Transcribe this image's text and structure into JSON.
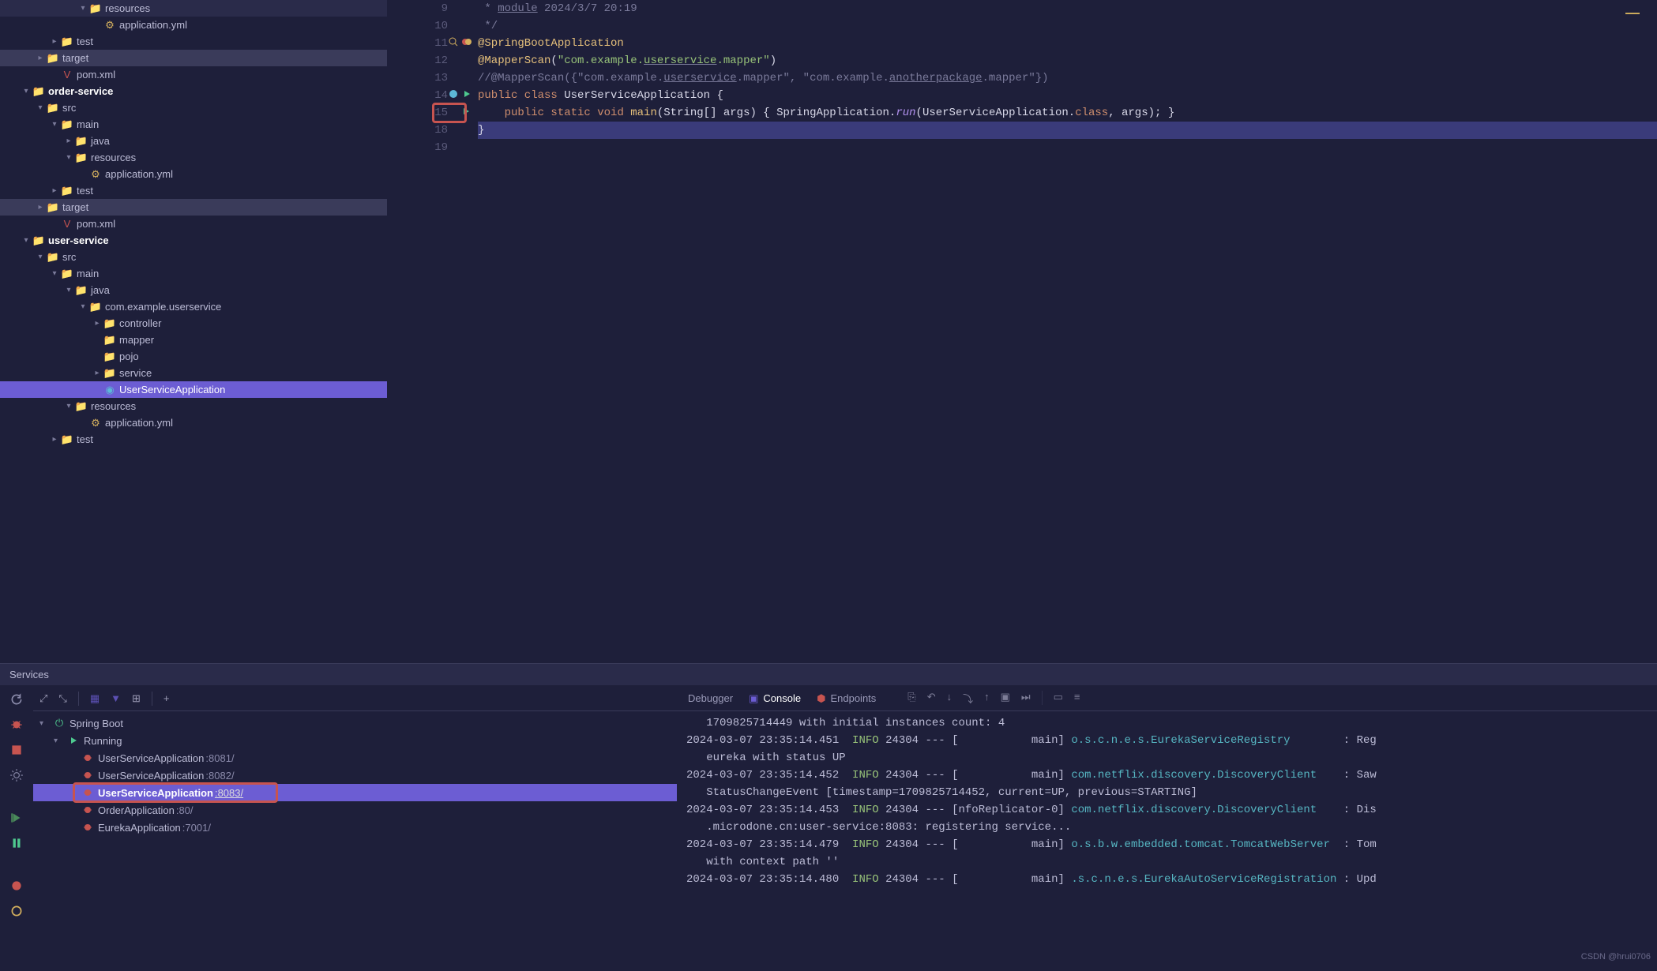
{
  "project_tree": [
    {
      "indent": 5,
      "chev": "v",
      "icon": "📁",
      "iconCls": "folder-purple",
      "label": "resources"
    },
    {
      "indent": 6,
      "chev": "",
      "icon": "⚙",
      "iconCls": "file-yellow",
      "label": "application.yml"
    },
    {
      "indent": 3,
      "chev": ">",
      "icon": "📁",
      "iconCls": "folder-green",
      "label": "test"
    },
    {
      "indent": 2,
      "chev": ">",
      "icon": "📁",
      "iconCls": "folder-maroon",
      "label": "target",
      "highlight": true
    },
    {
      "indent": 3,
      "chev": "",
      "icon": "V",
      "iconCls": "file-red",
      "label": "pom.xml"
    },
    {
      "indent": 1,
      "chev": "v",
      "icon": "📁",
      "iconCls": "folder-grey",
      "label": "order-service",
      "bold": true
    },
    {
      "indent": 2,
      "chev": "v",
      "icon": "📁",
      "iconCls": "folder-blue",
      "label": "src"
    },
    {
      "indent": 3,
      "chev": "v",
      "icon": "📁",
      "iconCls": "folder-grey",
      "label": "main"
    },
    {
      "indent": 4,
      "chev": ">",
      "icon": "📁",
      "iconCls": "folder-blue",
      "label": "java"
    },
    {
      "indent": 4,
      "chev": "v",
      "icon": "📁",
      "iconCls": "folder-purple",
      "label": "resources"
    },
    {
      "indent": 5,
      "chev": "",
      "icon": "⚙",
      "iconCls": "file-yellow",
      "label": "application.yml"
    },
    {
      "indent": 3,
      "chev": ">",
      "icon": "📁",
      "iconCls": "folder-green",
      "label": "test"
    },
    {
      "indent": 2,
      "chev": ">",
      "icon": "📁",
      "iconCls": "folder-maroon",
      "label": "target",
      "highlight": true
    },
    {
      "indent": 3,
      "chev": "",
      "icon": "V",
      "iconCls": "file-red",
      "label": "pom.xml"
    },
    {
      "indent": 1,
      "chev": "v",
      "icon": "📁",
      "iconCls": "folder-grey",
      "label": "user-service",
      "bold": true
    },
    {
      "indent": 2,
      "chev": "v",
      "icon": "📁",
      "iconCls": "folder-blue",
      "label": "src"
    },
    {
      "indent": 3,
      "chev": "v",
      "icon": "📁",
      "iconCls": "folder-grey",
      "label": "main"
    },
    {
      "indent": 4,
      "chev": "v",
      "icon": "📁",
      "iconCls": "folder-grey",
      "label": "java"
    },
    {
      "indent": 5,
      "chev": "v",
      "icon": "📁",
      "iconCls": "folder-grey",
      "label": "com.example.userservice"
    },
    {
      "indent": 6,
      "chev": ">",
      "icon": "📁",
      "iconCls": "file-pink",
      "label": "controller"
    },
    {
      "indent": 6,
      "chev": "",
      "icon": "📁",
      "iconCls": "folder-yellow",
      "label": "mapper"
    },
    {
      "indent": 6,
      "chev": "",
      "icon": "📁",
      "iconCls": "folder-yellow",
      "label": "pojo"
    },
    {
      "indent": 6,
      "chev": ">",
      "icon": "📁",
      "iconCls": "folder-blue",
      "label": "service"
    },
    {
      "indent": 6,
      "chev": "",
      "icon": "◉",
      "iconCls": "file-cyan",
      "label": "UserServiceApplication",
      "selected": true
    },
    {
      "indent": 4,
      "chev": "v",
      "icon": "📁",
      "iconCls": "folder-purple",
      "label": "resources"
    },
    {
      "indent": 5,
      "chev": "",
      "icon": "⚙",
      "iconCls": "file-yellow",
      "label": "application.yml"
    },
    {
      "indent": 3,
      "chev": ">",
      "icon": "📁",
      "iconCls": "folder-green",
      "label": "test"
    }
  ],
  "editor_lines": [
    {
      "num": 9,
      "html": " <span class='kw-grey'>* <span class='underline'>module</span> 2024/3/7 20:19</span>"
    },
    {
      "num": 10,
      "html": " <span class='kw-grey'>*/</span>"
    },
    {
      "num": 11,
      "html": "<span class='kw-yellow'>@SpringBootApplication</span>",
      "gutter": "magnify-circles"
    },
    {
      "num": 12,
      "html": "<span class='kw-yellow'>@MapperScan</span><span class='kw-white'>(</span><span class='kw-green'>\"com.example.<span class='underline'>userservice</span>.mapper\"</span><span class='kw-white'>)</span>"
    },
    {
      "num": 13,
      "html": "<span class='kw-grey'>//@MapperScan({\"com.example.<span class='underline'>userservice</span>.mapper\", \"com.example.<span class='underline'>anotherpackage</span>.mapper\"})</span>"
    },
    {
      "num": 14,
      "html": "<span class='kw-orange'>public class </span><span class='kw-white'>UserServiceApplication {</span>",
      "gutter": "run-both"
    },
    {
      "num": 15,
      "html": "    <span class='kw-orange'>public static </span><span class='kw-orange'>void </span><span class='kw-yellow'>main</span><span class='kw-white'>(</span><span class='kw-white'>String[] args</span><span class='kw-white'>) { </span><span class='kw-white'>SpringApplication.</span><span class='kw-purple kw-italic'>run</span><span class='kw-white'>(UserServiceApplication.</span><span class='kw-orange'>class</span><span class='kw-white'>, args); }</span>",
      "gutter": "run",
      "redbox": true
    },
    {
      "num": 18,
      "html": "<span class='kw-white'>}</span>",
      "hl": true
    },
    {
      "num": 19,
      "html": ""
    }
  ],
  "services": {
    "title": "Services",
    "spring_boot": "Spring Boot",
    "running": "Running",
    "runs": [
      {
        "name": "UserServiceApplication",
        "port": ":8081/"
      },
      {
        "name": "UserServiceApplication",
        "port": ":8082/"
      },
      {
        "name": "UserServiceApplication",
        "port": ":8083/",
        "selected": true,
        "box": true
      },
      {
        "name": "OrderApplication",
        "port": ":80/"
      },
      {
        "name": "EurekaApplication",
        "port": ":7001/"
      }
    ],
    "tabs": {
      "debugger": "Debugger",
      "console": "Console",
      "endpoints": "Endpoints"
    }
  },
  "console_lines": [
    {
      "text": "   1709825714449 with initial instances count: 4",
      "plain": true
    },
    {
      "ts": "2024-03-07 23:35:14.451",
      "lvl": "INFO",
      "pid": "24304",
      "thread": "main",
      "cls": "o.s.c.n.e.s.EurekaServiceRegistry",
      "msg": ": Reg"
    },
    {
      "text": "   eureka with status UP",
      "plain": true
    },
    {
      "ts": "2024-03-07 23:35:14.452",
      "lvl": "INFO",
      "pid": "24304",
      "thread": "main",
      "cls": "com.netflix.discovery.DiscoveryClient",
      "msg": ": Saw"
    },
    {
      "text": "   StatusChangeEvent [timestamp=1709825714452, current=UP, previous=STARTING]",
      "plain": true
    },
    {
      "ts": "2024-03-07 23:35:14.453",
      "lvl": "INFO",
      "pid": "24304",
      "thread": "nfoReplicator-0",
      "cls": "com.netflix.discovery.DiscoveryClient",
      "msg": ": Dis"
    },
    {
      "text": "   .microdone.cn:user-service:8083: registering service...",
      "plain": true
    },
    {
      "ts": "2024-03-07 23:35:14.479",
      "lvl": "INFO",
      "pid": "24304",
      "thread": "main",
      "cls": "o.s.b.w.embedded.tomcat.TomcatWebServer",
      "msg": ": Tom"
    },
    {
      "text": "   with context path ''",
      "plain": true
    },
    {
      "ts": "2024-03-07 23:35:14.480",
      "lvl": "INFO",
      "pid": "24304",
      "thread": "main",
      "cls": ".s.c.n.e.s.EurekaAutoServiceRegistration",
      "msg": ": Upd"
    }
  ],
  "watermark": "CSDN @hrui0706"
}
